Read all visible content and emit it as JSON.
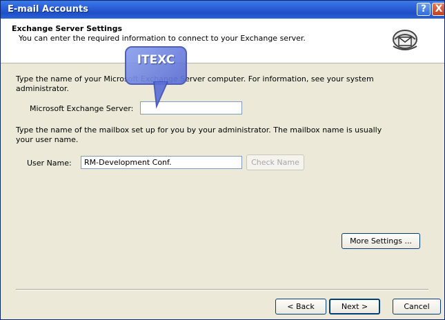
{
  "window": {
    "title": "E-mail Accounts",
    "help_button": "?",
    "close_button": "X"
  },
  "header": {
    "title": "Exchange Server Settings",
    "subtitle": "You can enter the required information to connect to your Exchange server."
  },
  "server_section": {
    "instruction": "Type the name of your Microsoft Exchange Server computer. For information, see your system administrator.",
    "label": "Microsoft Exchange Server:",
    "value": ""
  },
  "callout": {
    "text": "ITEXC"
  },
  "mailbox_section": {
    "instruction": "Type the name of the mailbox set up for you by your administrator. The mailbox name is usually your user name.",
    "user_name_label": "User Name:",
    "user_name_value": "RM-Development Conf.",
    "check_name_label": "Check Name"
  },
  "more_settings_label": "More Settings ...",
  "footer": {
    "back_label": "< Back",
    "next_label": "Next >",
    "cancel_label": "Cancel"
  },
  "colors": {
    "titlebar": "#2b5fd9",
    "dialog_bg": "#ece9d8",
    "callout": "#6b7fe0"
  }
}
